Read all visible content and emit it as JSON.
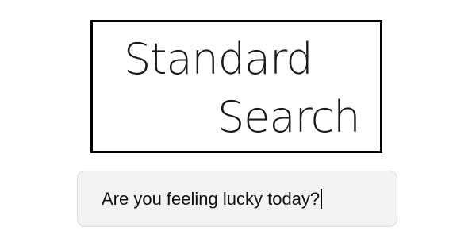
{
  "logo": {
    "line1": "Standard",
    "line2": "Search"
  },
  "search": {
    "value": "Are you feeling lucky today?"
  },
  "colors": {
    "logo_border": "#000000",
    "search_background": "#f3f3f3",
    "search_border": "#dcdcdc"
  }
}
